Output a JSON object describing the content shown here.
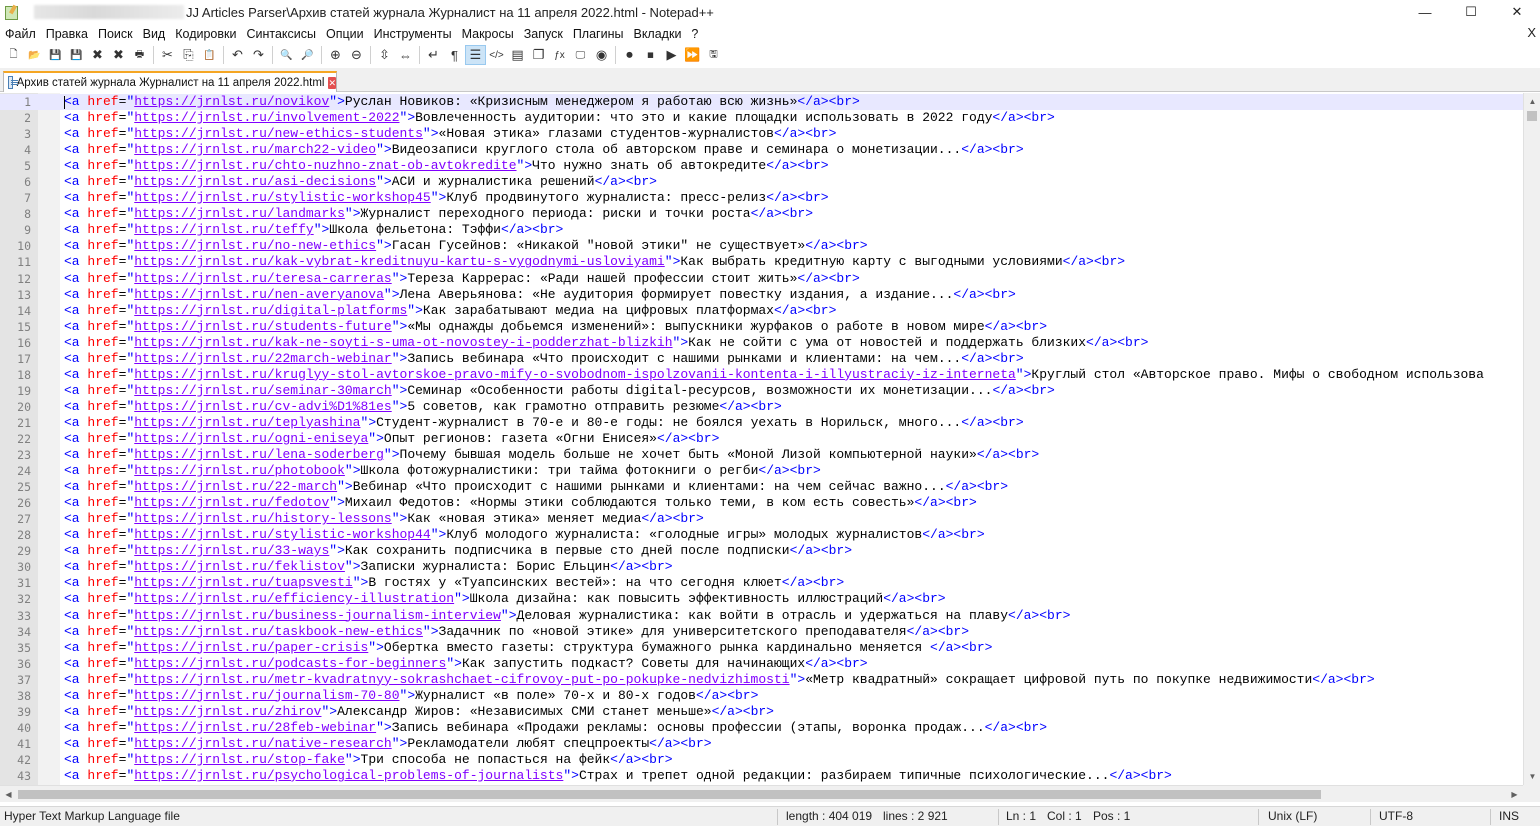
{
  "window": {
    "title": "JJ Articles Parser\\Архив статей журнала Журналист на 11 апреля 2022.html - Notepad++",
    "controls": {
      "minimize": "—",
      "maximize": "☐",
      "close": "✕"
    }
  },
  "menu": {
    "items": [
      "Файл",
      "Правка",
      "Поиск",
      "Вид",
      "Кодировки",
      "Синтаксисы",
      "Опции",
      "Инструменты",
      "Макросы",
      "Запуск",
      "Плагины",
      "Вкладки",
      "?"
    ],
    "close_glyph": "X"
  },
  "toolbar": {
    "buttons": [
      {
        "name": "new-file-icon",
        "glyph": "🗋"
      },
      {
        "name": "open-file-icon",
        "glyph": "📂"
      },
      {
        "name": "save-icon",
        "glyph": "💾"
      },
      {
        "name": "save-all-icon",
        "glyph": "💾"
      },
      {
        "name": "close-icon",
        "glyph": "✖"
      },
      {
        "name": "close-all-icon",
        "glyph": "✖"
      },
      {
        "name": "print-icon",
        "glyph": "🖶"
      },
      {
        "sep": true
      },
      {
        "name": "cut-icon",
        "glyph": "✂"
      },
      {
        "name": "copy-icon",
        "glyph": "⎘"
      },
      {
        "name": "paste-icon",
        "glyph": "📋"
      },
      {
        "sep": true
      },
      {
        "name": "undo-icon",
        "glyph": "↶"
      },
      {
        "name": "redo-icon",
        "glyph": "↷"
      },
      {
        "sep": true
      },
      {
        "name": "find-icon",
        "glyph": "🔍"
      },
      {
        "name": "replace-icon",
        "glyph": "🔎"
      },
      {
        "sep": true
      },
      {
        "name": "zoom-in-icon",
        "glyph": "⊕"
      },
      {
        "name": "zoom-out-icon",
        "glyph": "⊖"
      },
      {
        "sep": true
      },
      {
        "name": "sync-vertical-icon",
        "glyph": "⇳"
      },
      {
        "name": "sync-horizontal-icon",
        "glyph": "⇔"
      },
      {
        "sep": true
      },
      {
        "name": "word-wrap-icon",
        "glyph": "↵"
      },
      {
        "name": "show-all-chars-icon",
        "glyph": "¶"
      },
      {
        "name": "indent-guide-icon",
        "glyph": "☰",
        "active": true
      },
      {
        "name": "xml-tag-icon",
        "glyph": "</>"
      },
      {
        "name": "doc-map-icon",
        "glyph": "▤"
      },
      {
        "name": "doc-list-icon",
        "glyph": "❐"
      },
      {
        "name": "function-list-icon",
        "glyph": "ƒx"
      },
      {
        "name": "folder-workspace-icon",
        "glyph": "🖵"
      },
      {
        "name": "monitoring-icon",
        "glyph": "◉"
      },
      {
        "sep": true
      },
      {
        "name": "record-macro-icon",
        "glyph": "⏺"
      },
      {
        "name": "stop-macro-icon",
        "glyph": "⏹"
      },
      {
        "name": "play-macro-icon",
        "glyph": "▶"
      },
      {
        "name": "run-macro-multiple-icon",
        "glyph": "⏩"
      },
      {
        "name": "save-macro-icon",
        "glyph": "🖫"
      }
    ]
  },
  "tab": {
    "label": "Архив статей журнала Журналист на 11 апреля 2022.html",
    "close_glyph": "✕"
  },
  "editor": {
    "lines": [
      {
        "n": "1",
        "url": "https://jrnlst.ru/novikov",
        "text": "Руслан Новиков: «Кризисным менеджером я работаю всю жизнь»"
      },
      {
        "n": "2",
        "url": "https://jrnlst.ru/involvement-2022",
        "text": "Вовлеченность аудитории: что это и какие площадки использовать в 2022 году"
      },
      {
        "n": "3",
        "url": "https://jrnlst.ru/new-ethics-students",
        "text": "«Новая этика» глазами студентов-журналистов"
      },
      {
        "n": "4",
        "url": "https://jrnlst.ru/march22-video",
        "text": "Видеозаписи круглого стола об авторском праве и семинара о монетизации..."
      },
      {
        "n": "5",
        "url": "https://jrnlst.ru/chto-nuzhno-znat-ob-avtokredite",
        "text": "Что нужно знать об автокредите"
      },
      {
        "n": "6",
        "url": "https://jrnlst.ru/asi-decisions",
        "text": "АСИ и журналистика решений"
      },
      {
        "n": "7",
        "url": "https://jrnlst.ru/stylistic-workshop45",
        "text": "Клуб продвинутого журналиста: пресс-релиз"
      },
      {
        "n": "8",
        "url": "https://jrnlst.ru/landmarks",
        "text": "Журналист переходного периода: риски и точки роста"
      },
      {
        "n": "9",
        "url": "https://jrnlst.ru/teffy",
        "text": "Школа фельетона: Тэффи"
      },
      {
        "n": "10",
        "url": "https://jrnlst.ru/no-new-ethics",
        "text": "Гасан Гусейнов: «Никакой \"новой этики\" не существует»"
      },
      {
        "n": "11",
        "url": "https://jrnlst.ru/kak-vybrat-kreditnuyu-kartu-s-vygodnymi-usloviyami",
        "text": "Как выбрать кредитную карту с выгодными условиями"
      },
      {
        "n": "12",
        "url": "https://jrnlst.ru/teresa-carreras",
        "text": "Тереза Каррерас: «Ради нашей профессии стоит жить»"
      },
      {
        "n": "13",
        "url": "https://jrnlst.ru/nen-averyanova",
        "text": "Лена Аверьянова: «Не аудитория формирует повестку издания, а издание..."
      },
      {
        "n": "14",
        "url": "https://jrnlst.ru/digital-platforms",
        "text": "Как зарабатывают медиа на цифровых платформах"
      },
      {
        "n": "15",
        "url": "https://jrnlst.ru/students-future",
        "text": "«Мы однажды добьемся изменений»: выпускники журфаков о работе в новом мире"
      },
      {
        "n": "16",
        "url": "https://jrnlst.ru/kak-ne-soyti-s-uma-ot-novostey-i-podderzhat-blizkih",
        "text": "Как не сойти с ума от новостей и поддержать близких"
      },
      {
        "n": "17",
        "url": "https://jrnlst.ru/22march-webinar",
        "text": "Запись вебинара «Что происходит с нашими рынками и клиентами: на чем..."
      },
      {
        "n": "18",
        "url": "https://jrnlst.ru/kruglyy-stol-avtorskoe-pravo-mify-o-svobodnom-ispolzovanii-kontenta-i-illyustraciy-iz-interneta",
        "text": "Круглый стол «Авторское право. Мифы о свободном использова"
      },
      {
        "n": "19",
        "url": "https://jrnlst.ru/seminar-30march",
        "text": "Семинар «Особенности работы digital-ресурсов, возможности их монетизации..."
      },
      {
        "n": "20",
        "url": "https://jrnlst.ru/cv-advi%D1%81es",
        "text": "5 советов, как грамотно отправить резюме"
      },
      {
        "n": "21",
        "url": "https://jrnlst.ru/teplyashina",
        "text": "Студент-журналист в 70-е и 80-е годы: не боялся уехать в Норильск, много..."
      },
      {
        "n": "22",
        "url": "https://jrnlst.ru/ogni-eniseya",
        "text": "Опыт регионов: газета «Огни Енисея»"
      },
      {
        "n": "23",
        "url": "https://jrnlst.ru/lena-soderberg",
        "text": "Почему бывшая модель больше не хочет быть «Моной Лизой компьютерной науки»"
      },
      {
        "n": "24",
        "url": "https://jrnlst.ru/photobook",
        "text": "Школа фотожурналистики: три тайма фотокниги о регби"
      },
      {
        "n": "25",
        "url": "https://jrnlst.ru/22-march",
        "text": "Вебинар «Что происходит с нашими рынками и клиентами: на чем сейчас важно..."
      },
      {
        "n": "26",
        "url": "https://jrnlst.ru/fedotov",
        "text": "Михаил Федотов: «Нормы этики соблюдаются только теми, в ком есть совесть»"
      },
      {
        "n": "27",
        "url": "https://jrnlst.ru/history-lessons",
        "text": "Как «новая этика» меняет медиа"
      },
      {
        "n": "28",
        "url": "https://jrnlst.ru/stylistic-workshop44",
        "text": "Клуб молодого журналиста: «голодные игры» молодых журналистов"
      },
      {
        "n": "29",
        "url": "https://jrnlst.ru/33-ways",
        "text": "Как сохранить подписчика в первые сто дней после подписки"
      },
      {
        "n": "30",
        "url": "https://jrnlst.ru/feklistov",
        "text": "Записки журналиста: Борис Ельцин"
      },
      {
        "n": "31",
        "url": "https://jrnlst.ru/tuapsvesti",
        "text": "В гостях у «Туапсинских вестей»: на что сегодня клюет"
      },
      {
        "n": "32",
        "url": "https://jrnlst.ru/efficiency-illustration",
        "text": "Школа дизайна: как повысить эффективность иллюстраций"
      },
      {
        "n": "33",
        "url": "https://jrnlst.ru/business-journalism-interview",
        "text": "Деловая журналистика: как войти в отрасль и удержаться на плаву"
      },
      {
        "n": "34",
        "url": "https://jrnlst.ru/taskbook-new-ethics",
        "text": "Задачник по «новой этике» для университетского преподавателя"
      },
      {
        "n": "35",
        "url": "https://jrnlst.ru/paper-crisis",
        "text": "Обертка вместо газеты: структура бумажного рынка кардинально меняется "
      },
      {
        "n": "36",
        "url": "https://jrnlst.ru/podcasts-for-beginners",
        "text": "Как запустить подкаст? Советы для начинающих"
      },
      {
        "n": "37",
        "url": "https://jrnlst.ru/metr-kvadratnyy-sokrashchaet-cifrovoy-put-po-pokupke-nedvizhimosti",
        "text": "«Метр квадратный» сокращает цифровой путь по покупке недвижимости"
      },
      {
        "n": "38",
        "url": "https://jrnlst.ru/journalism-70-80",
        "text": "Журналист «в поле» 70-х и 80-х годов"
      },
      {
        "n": "39",
        "url": "https://jrnlst.ru/zhirov",
        "text": "Александр Жиров: «Независимых СМИ станет меньше»"
      },
      {
        "n": "40",
        "url": "https://jrnlst.ru/28feb-webinar",
        "text": "Запись вебинара «Продажи рекламы: основы профессии (этапы, воронка продаж..."
      },
      {
        "n": "41",
        "url": "https://jrnlst.ru/native-research",
        "text": "Рекламодатели любят спецпроекты"
      },
      {
        "n": "42",
        "url": "https://jrnlst.ru/stop-fake",
        "text": "Три способа не попасться на фейк"
      },
      {
        "n": "43",
        "url": "https://jrnlst.ru/psychological-problems-of-journalists",
        "text": "Страх и трепет одной редакции: разбираем типичные психологические..."
      }
    ],
    "truncate_line": "18"
  },
  "statusbar": {
    "file_type": "Hyper Text Markup Language file",
    "length": "length : 404 019",
    "lines": "lines : 2 921",
    "ln": "Ln : 1",
    "col": "Col : 1",
    "pos": "Pos : 1",
    "eol": "Unix (LF)",
    "encoding": "UTF-8",
    "mode": "INS"
  }
}
